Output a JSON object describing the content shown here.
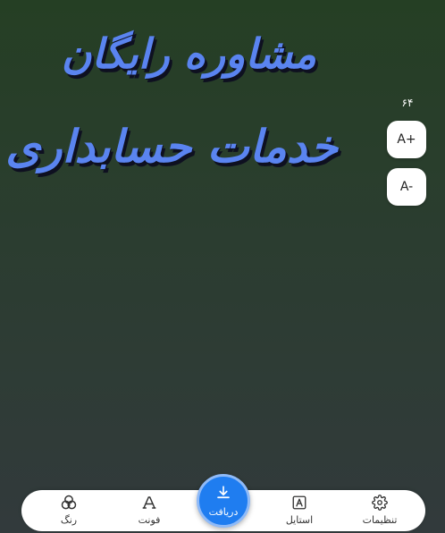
{
  "canvas": {
    "line1": "مشاوره رایگان",
    "line2": "خدمات حسابداری",
    "text_color": "#5a84f0",
    "shadow_color": "#0e1020",
    "background_top": "#253f24",
    "background_bottom": "#323a3c"
  },
  "font_size": {
    "value": "۶۴",
    "increase_label": "A+",
    "decrease_label": "A-"
  },
  "bottom_nav": {
    "settings": {
      "label": "تنظیمات",
      "icon": "gear-icon"
    },
    "style": {
      "label": "استایل",
      "icon": "style-icon"
    },
    "download": {
      "label": "دریافت",
      "icon": "download-icon",
      "color": "#1f7df0"
    },
    "font": {
      "label": "فونت",
      "icon": "font-icon"
    },
    "color": {
      "label": "رنگ",
      "icon": "color-circles-icon"
    }
  }
}
